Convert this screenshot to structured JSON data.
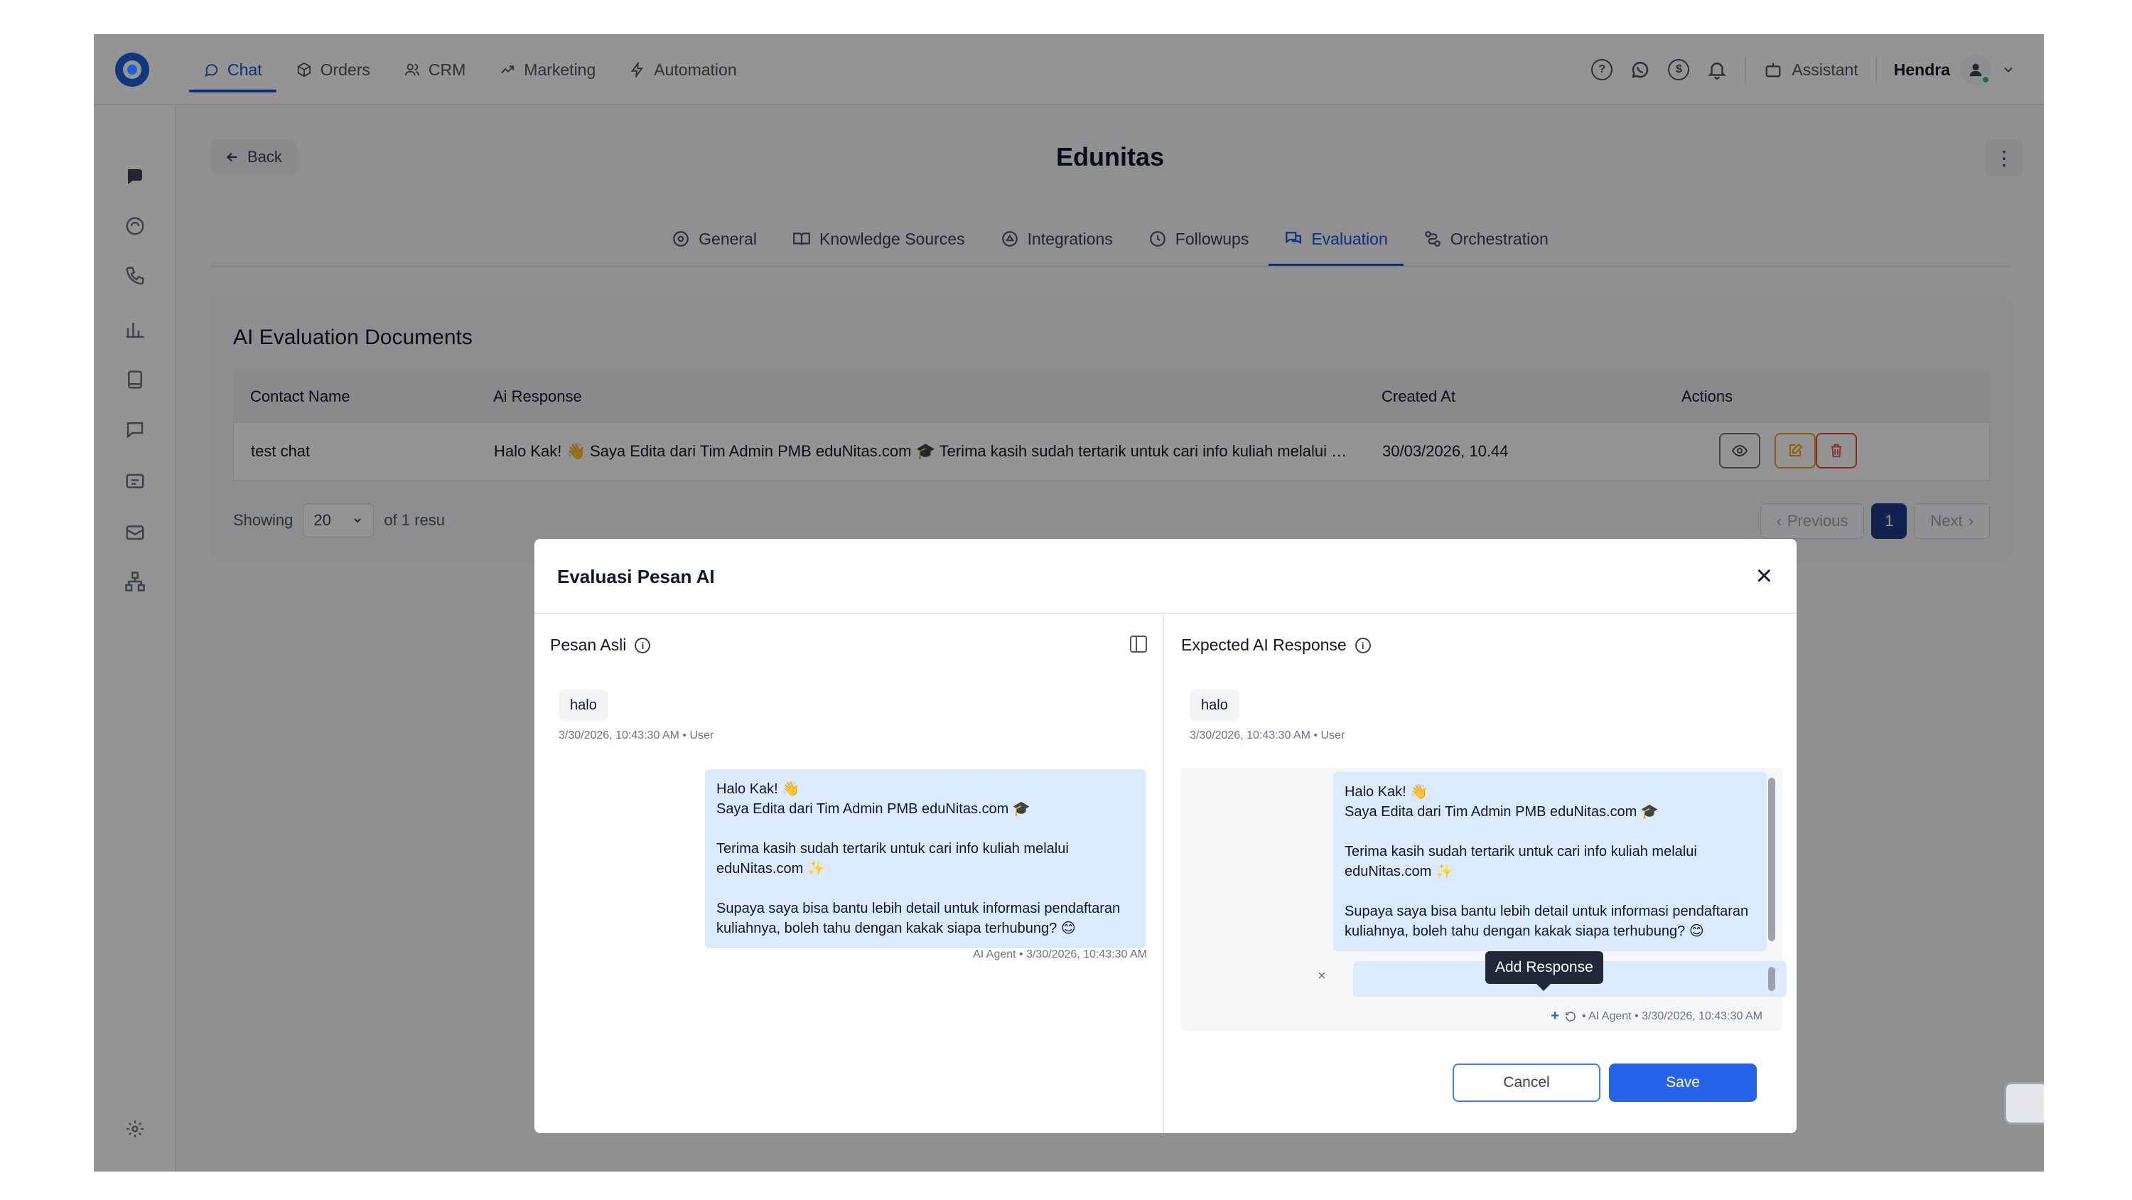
{
  "topnav": {
    "items": [
      {
        "label": "Chat",
        "icon": "chat-bubble-icon",
        "active": true
      },
      {
        "label": "Orders",
        "icon": "box-icon",
        "active": false
      },
      {
        "label": "CRM",
        "icon": "users-icon",
        "active": false
      },
      {
        "label": "Marketing",
        "icon": "trend-up-icon",
        "active": false
      },
      {
        "label": "Automation",
        "icon": "lightning-icon",
        "active": false
      }
    ],
    "assistant_label": "Assistant",
    "user_name": "Hendra"
  },
  "header": {
    "back_label": "Back",
    "title": "Edunitas"
  },
  "tabs": [
    {
      "label": "General",
      "active": false
    },
    {
      "label": "Knowledge Sources",
      "active": false
    },
    {
      "label": "Integrations",
      "active": false
    },
    {
      "label": "Followups",
      "active": false
    },
    {
      "label": "Evaluation",
      "active": true
    },
    {
      "label": "Orchestration",
      "active": false
    }
  ],
  "documents": {
    "title": "AI Evaluation Documents",
    "columns": [
      "Contact Name",
      "Ai Response",
      "Created At",
      "Actions"
    ],
    "rows": [
      {
        "contact_name": "test chat",
        "ai_response": "Halo Kak! 👋 Saya Edita dari Tim Admin PMB eduNitas.com 🎓 Terima kasih sudah tertarik untuk cari info kuliah melalui edu...",
        "created_at": "30/03/2026, 10.44"
      }
    ],
    "pagination": {
      "showing_label": "Showing",
      "page_size": "20",
      "of_label": "of 1 resu",
      "previous_label": "Previous",
      "current_page": "1",
      "next_label": "Next"
    }
  },
  "modal": {
    "title": "Evaluasi Pesan AI",
    "left": {
      "header": "Pesan Asli",
      "user_message": "halo",
      "user_meta": "3/30/2026, 10:43:30 AM • User",
      "ai_lines": [
        "Halo Kak! 👋",
        "Saya Edita dari Tim Admin PMB eduNitas.com 🎓",
        "",
        "Terima kasih sudah tertarik untuk cari info kuliah melalui",
        "eduNitas.com ✨",
        "",
        "Supaya saya bisa bantu lebih detail untuk informasi pendaftaran",
        "kuliahnya, boleh tahu dengan kakak siapa terhubung? 😊"
      ],
      "ai_meta": "AI Agent • 3/30/2026, 10:43:30 AM"
    },
    "right": {
      "header": "Expected AI Response",
      "user_message": "halo",
      "user_meta": "3/30/2026, 10:43:30 AM • User",
      "ai_lines": [
        "Halo Kak! 👋",
        "Saya Edita dari Tim Admin PMB eduNitas.com 🎓",
        "",
        "Terima kasih sudah tertarik untuk cari info kuliah melalui",
        "eduNitas.com ✨",
        "",
        "Supaya saya bisa bantu lebih detail untuk informasi pendaftaran",
        "kuliahnya, boleh tahu dengan kakak siapa terhubung? 😊"
      ],
      "tooltip": "Add Response",
      "remove_glyph": "×",
      "ai_meta": "• AI Agent • 3/30/2026, 10:43:30 AM"
    },
    "cancel_label": "Cancel",
    "save_label": "Save"
  },
  "colors": {
    "primary": "#2563eb",
    "nav_active": "#1d4ed8",
    "ai_bubble": "#dbeafe",
    "edit_action": "#f59e0b",
    "delete_action": "#ef4444"
  }
}
